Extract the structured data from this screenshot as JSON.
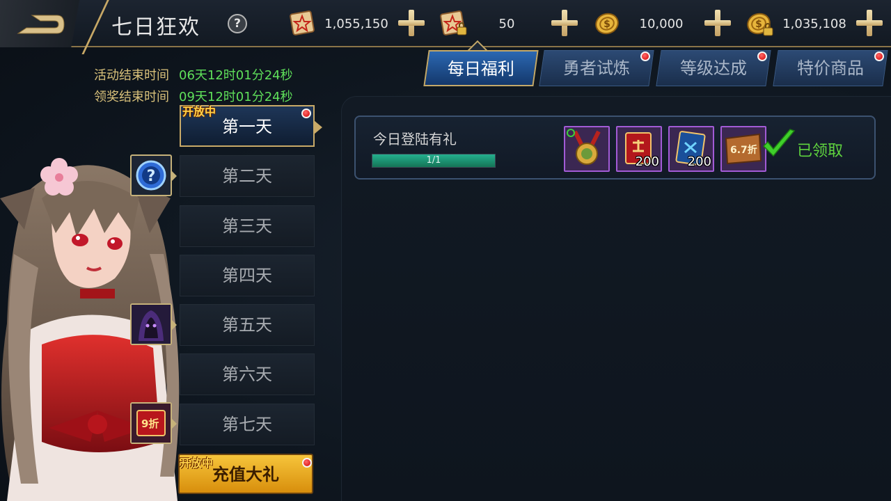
{
  "header": {
    "title": "七日狂欢",
    "help_icon": "question-icon"
  },
  "resources": [
    {
      "icon": "scroll-pentagram-icon",
      "value": "1,055,150"
    },
    {
      "icon": "scroll-locked-icon",
      "value": "50"
    },
    {
      "icon": "gold-coin-icon",
      "value": "10,000"
    },
    {
      "icon": "gold-coin-locked-icon",
      "value": "1,035,108"
    }
  ],
  "event": {
    "end_label": "活动结束时间",
    "end_value": "06天12时01分24秒",
    "claim_label": "领奖结束时间",
    "claim_value": "09天12时01分24秒"
  },
  "days": [
    {
      "label": "第一天",
      "tag": "开放中",
      "active": true
    },
    {
      "label": "第二天"
    },
    {
      "label": "第三天"
    },
    {
      "label": "第四天"
    },
    {
      "label": "第五天"
    },
    {
      "label": "第六天"
    },
    {
      "label": "第七天"
    }
  ],
  "recharge": {
    "tag": "开放中",
    "label": "充值大礼"
  },
  "day_side_icons": [
    "mystery-orb-icon",
    "hooded-hero-icon",
    "discount-card-icon"
  ],
  "discount_card_text": "9折",
  "tabs": [
    {
      "label": "每日福利",
      "active": true
    },
    {
      "label": "勇者试炼",
      "badge": true
    },
    {
      "label": "等级达成",
      "badge": true
    },
    {
      "label": "特价商品",
      "badge": true
    }
  ],
  "task": {
    "title": "今日登陆有礼",
    "progress_text": "1/1",
    "progress": 1.0,
    "rewards": [
      {
        "icon": "medal-icon",
        "count": ""
      },
      {
        "icon": "red-book-icon",
        "count": "200"
      },
      {
        "icon": "blue-scroll-icon",
        "count": "200"
      },
      {
        "icon": "discount-coupon-icon",
        "count": "",
        "coupon_text": "6.7折"
      }
    ],
    "status": "已领取"
  },
  "colors": {
    "accent_gold": "#c9aa68",
    "claimed_green": "#5fd43e",
    "time_green": "#5fe05a",
    "label_gold": "#d8c07a",
    "badge_red": "#d30000"
  }
}
